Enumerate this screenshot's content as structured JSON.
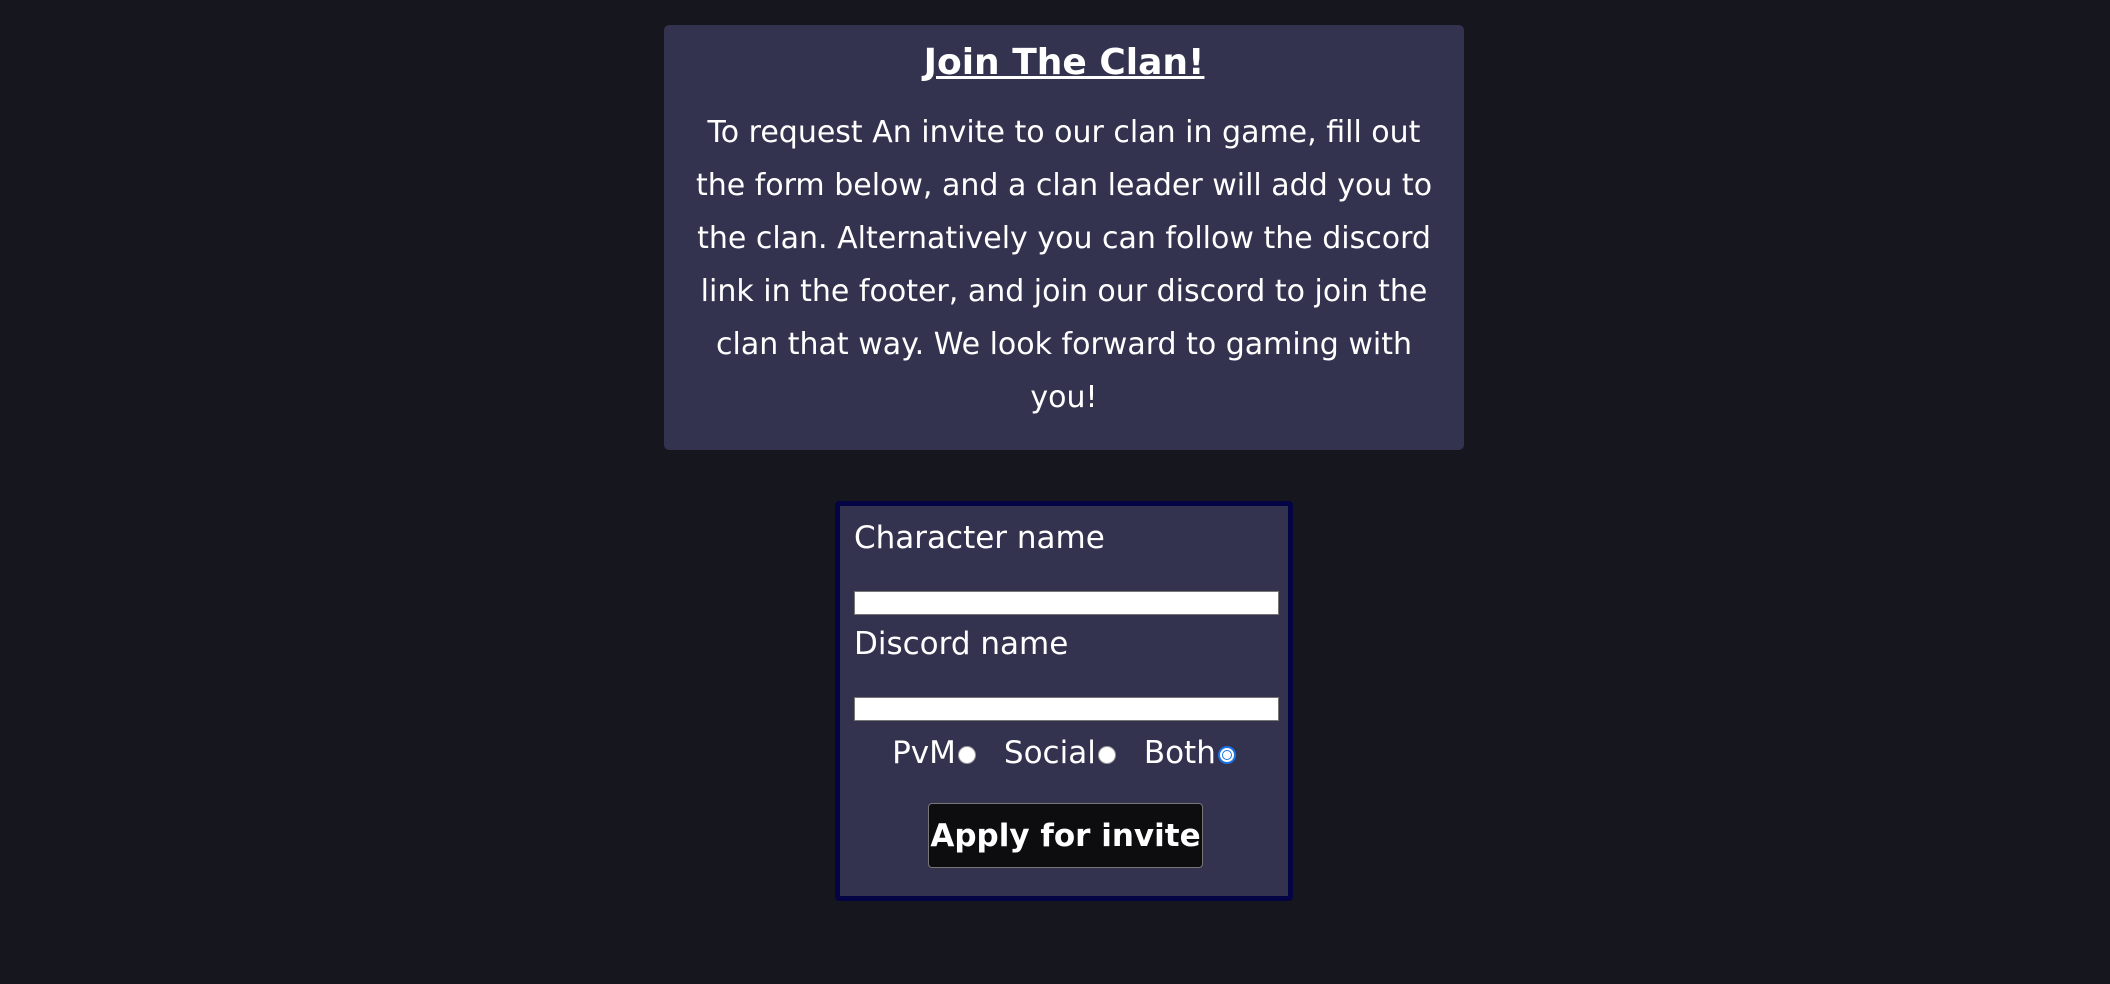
{
  "intro": {
    "title": "Join The Clan!",
    "text": "To request An invite to our clan in game, fill out the form below, and a clan leader will add you to the clan. Alternatively you can follow the discord link in the footer, and join our discord to join the clan that way. We look forward to gaming with you!"
  },
  "form": {
    "character_label": "Character name",
    "character_value": "",
    "discord_label": "Discord name",
    "discord_value": "",
    "options": [
      {
        "label": "PvM",
        "checked": false
      },
      {
        "label": "Social",
        "checked": false
      },
      {
        "label": "Both",
        "checked": true
      }
    ],
    "submit_label": "Apply for invite"
  },
  "colors": {
    "page_background": "#16161e",
    "card_background": "#333350",
    "form_border": "#040444",
    "button_background": "#0d0d10",
    "radio_selected": "#1a73e8"
  }
}
